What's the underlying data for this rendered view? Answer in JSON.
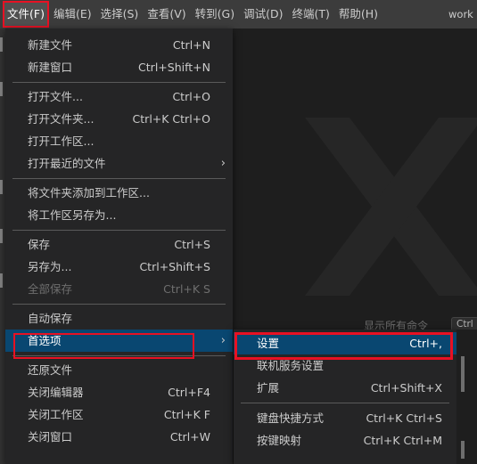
{
  "menubar": {
    "items": [
      {
        "label": "文件(F)"
      },
      {
        "label": "编辑(E)"
      },
      {
        "label": "选择(S)"
      },
      {
        "label": "查看(V)"
      },
      {
        "label": "转到(G)"
      },
      {
        "label": "调试(D)"
      },
      {
        "label": "终端(T)"
      },
      {
        "label": "帮助(H)"
      }
    ],
    "window_title": "work"
  },
  "file_menu": {
    "new_file": {
      "label": "新建文件",
      "shortcut": "Ctrl+N"
    },
    "new_window": {
      "label": "新建窗口",
      "shortcut": "Ctrl+Shift+N"
    },
    "open_file": {
      "label": "打开文件...",
      "shortcut": "Ctrl+O"
    },
    "open_folder": {
      "label": "打开文件夹...",
      "shortcut": "Ctrl+K Ctrl+O"
    },
    "open_workspace": {
      "label": "打开工作区..."
    },
    "open_recent": {
      "label": "打开最近的文件"
    },
    "add_folder": {
      "label": "将文件夹添加到工作区..."
    },
    "save_workspace_as": {
      "label": "将工作区另存为..."
    },
    "save": {
      "label": "保存",
      "shortcut": "Ctrl+S"
    },
    "save_as": {
      "label": "另存为...",
      "shortcut": "Ctrl+Shift+S"
    },
    "save_all": {
      "label": "全部保存",
      "shortcut": "Ctrl+K S"
    },
    "auto_save": {
      "label": "自动保存"
    },
    "preferences": {
      "label": "首选项"
    },
    "revert_file": {
      "label": "还原文件"
    },
    "close_editor": {
      "label": "关闭编辑器",
      "shortcut": "Ctrl+F4"
    },
    "close_workspace": {
      "label": "关闭工作区",
      "shortcut": "Ctrl+K F"
    },
    "close_window": {
      "label": "关闭窗口",
      "shortcut": "Ctrl+W"
    }
  },
  "pref_menu": {
    "settings": {
      "label": "设置",
      "shortcut": "Ctrl+,"
    },
    "online_settings": {
      "label": "联机服务设置"
    },
    "extensions": {
      "label": "扩展",
      "shortcut": "Ctrl+Shift+X"
    },
    "keyboard_shortcuts": {
      "label": "键盘快捷方式",
      "shortcut": "Ctrl+K Ctrl+S"
    },
    "keymaps": {
      "label": "按键映射",
      "shortcut": "Ctrl+K Ctrl+M"
    }
  },
  "editor": {
    "show_all_commands": "显示所有命令",
    "kbd_hint": "Ctrl"
  },
  "icons": {
    "submenu_arrow": "chevron-right-icon",
    "watermark": "vscode-logo-icon"
  },
  "colors": {
    "accent_selected": "#094771",
    "highlight_box": "#e81123",
    "menu_bg": "#252526",
    "menubar_bg": "#3c3c3c",
    "editor_bg": "#1e1e1e"
  }
}
